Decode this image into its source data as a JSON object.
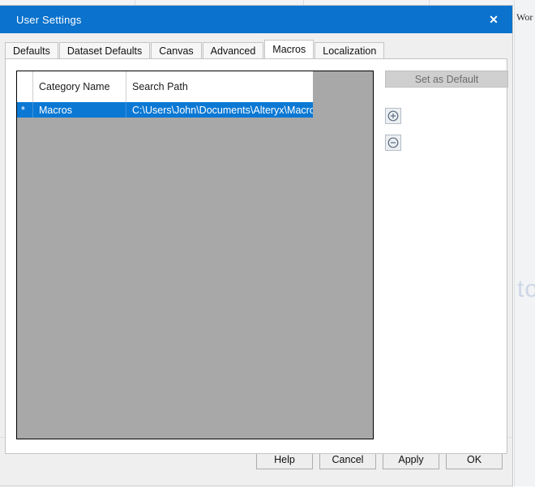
{
  "background": {
    "window_title": "Wor",
    "watermark": "to"
  },
  "dialog": {
    "title": "User Settings",
    "close_label": "✕",
    "tabs": [
      {
        "label": "Defaults",
        "active": false
      },
      {
        "label": "Dataset Defaults",
        "active": false
      },
      {
        "label": "Canvas",
        "active": false
      },
      {
        "label": "Advanced",
        "active": false
      },
      {
        "label": "Macros",
        "active": true
      },
      {
        "label": "Localization",
        "active": false
      }
    ],
    "grid": {
      "columns": [
        {
          "label": "",
          "key": "marker"
        },
        {
          "label": "Category Name",
          "key": "name"
        },
        {
          "label": "Search Path",
          "key": "path"
        }
      ],
      "rows": [
        {
          "marker": "*",
          "name": "Macros",
          "path": "C:\\Users\\John\\Documents\\Alteryx\\Macros",
          "selected": true
        }
      ]
    },
    "side_actions": {
      "set_as_default": "Set as Default",
      "add_icon": "⊕",
      "remove_icon": "⊖"
    },
    "footer_buttons": [
      {
        "label": "Help"
      },
      {
        "label": "Cancel"
      },
      {
        "label": "Apply"
      },
      {
        "label": "OK"
      }
    ]
  },
  "colors": {
    "titlebar": "#0b72cd",
    "selection": "#0b78d4",
    "grid_body": "#a8a8a8",
    "dialog_face": "#efeff0"
  }
}
